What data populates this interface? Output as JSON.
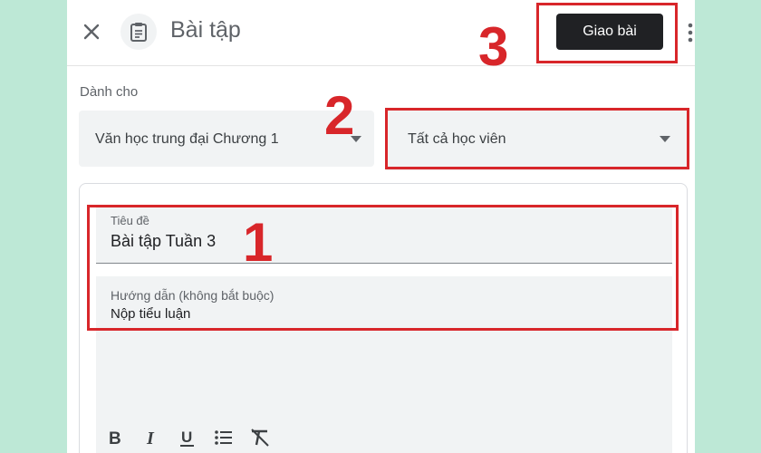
{
  "header": {
    "title": "Bài tập",
    "assign_label": "Giao bài"
  },
  "assign_for": {
    "label": "Dành cho",
    "class_value": "Văn học trung đại Chương 1",
    "students_value": "Tất cả học viên"
  },
  "form": {
    "title_label": "Tiêu đề",
    "title_value": "Bài tập Tuần 3",
    "instructions_label": "Hướng dẫn (không bắt buộc)",
    "instructions_value": "Nộp tiểu luận"
  },
  "toolbar": {
    "buttons": [
      "bold-icon",
      "italic-icon",
      "underline-icon",
      "bulleted-list-icon",
      "clear-formatting-icon"
    ]
  },
  "annotations": {
    "step1": "1",
    "step2": "2",
    "step3": "3",
    "color": "#d8262a"
  },
  "colors": {
    "background": "#bde8d6",
    "primary_button": "#202124"
  }
}
